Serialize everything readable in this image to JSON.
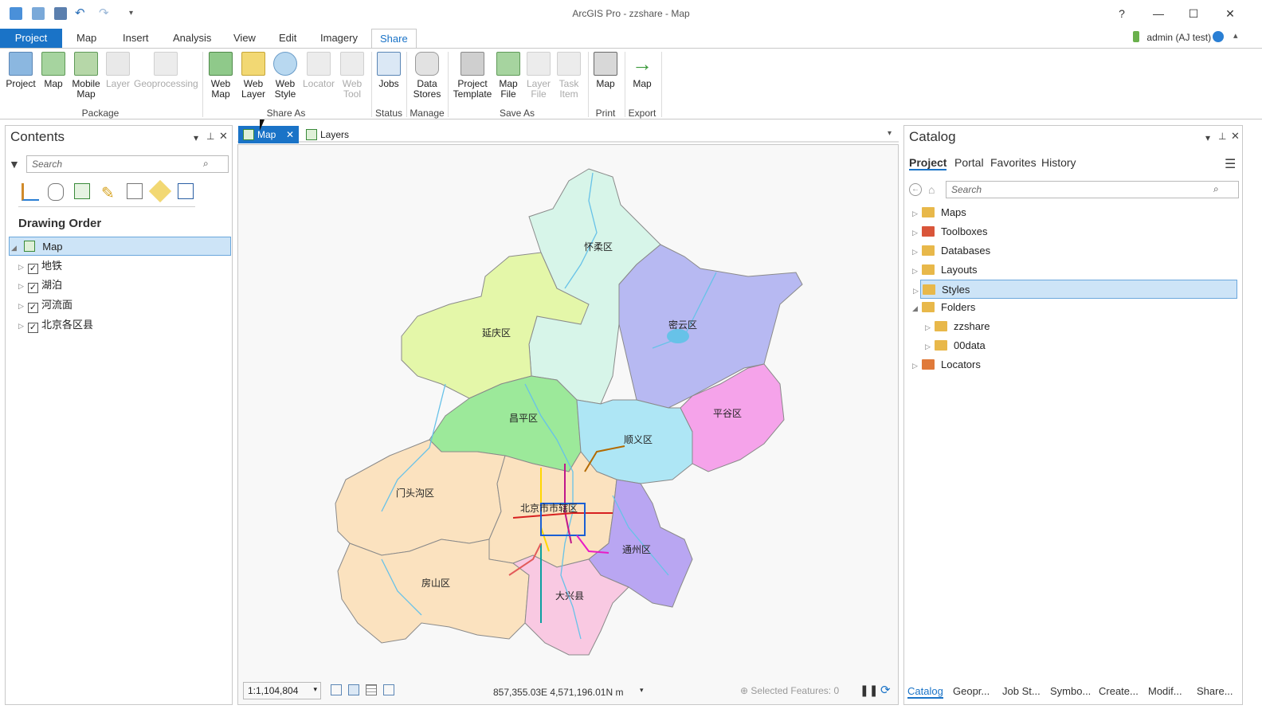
{
  "window": {
    "title": "ArcGIS Pro - zzshare - Map",
    "help": "?",
    "minimize": "—",
    "maximize": "☐",
    "close": "✕"
  },
  "ribbon_tabs": [
    "Project",
    "Map",
    "Insert",
    "Analysis",
    "View",
    "Edit",
    "Imagery",
    "Share"
  ],
  "active_tab": "Share",
  "user": {
    "name": "admin (AJ test)"
  },
  "ribbon": {
    "groups": [
      {
        "label": "Package",
        "buttons": [
          "Project",
          "Map",
          "Mobile Map",
          "Layer",
          "Geoprocessing"
        ]
      },
      {
        "label": "Share As",
        "buttons": [
          "Web Map",
          "Web Layer",
          "Web Style",
          "Locator",
          "Web Tool"
        ]
      },
      {
        "label": "Status",
        "buttons": [
          "Jobs"
        ]
      },
      {
        "label": "Manage",
        "buttons": [
          "Data Stores"
        ]
      },
      {
        "label": "Save As",
        "buttons": [
          "Project Template",
          "Map File",
          "Layer File",
          "Task Item"
        ]
      },
      {
        "label": "Print",
        "buttons": [
          "Map"
        ]
      },
      {
        "label": "Export",
        "buttons": [
          "Map"
        ]
      }
    ]
  },
  "contents": {
    "title": "Contents",
    "search_placeholder": "Search",
    "section": "Drawing Order",
    "map_name": "Map",
    "layers": [
      "地铁",
      "湖泊",
      "河流面",
      "北京各区县"
    ]
  },
  "doc_tabs": [
    "Map",
    "Layers"
  ],
  "map": {
    "districts": [
      {
        "name": "怀柔区",
        "color": "#d7f5e9"
      },
      {
        "name": "密云区",
        "color": "#b7b9f2"
      },
      {
        "name": "延庆区",
        "color": "#e4f7a9"
      },
      {
        "name": "平谷区",
        "color": "#f5a3ea"
      },
      {
        "name": "昌平区",
        "color": "#9ce99a"
      },
      {
        "name": "顺义区",
        "color": "#aee6f5"
      },
      {
        "name": "门头沟区",
        "color": "#fbe2bf"
      },
      {
        "name": "北京市市辖区",
        "color": "#fbe2bf"
      },
      {
        "name": "通州区",
        "color": "#b9a6f2"
      },
      {
        "name": "房山区",
        "color": "#fbe2bf"
      },
      {
        "name": "大兴县",
        "color": "#f9c9e2"
      }
    ],
    "scale": "1:1,104,804",
    "coordinates": "857,355.03E 4,571,196.01N m",
    "selected_features": "Selected Features: 0"
  },
  "catalog": {
    "title": "Catalog",
    "tabs": [
      "Project",
      "Portal",
      "Favorites",
      "History"
    ],
    "search_placeholder": "Search",
    "items": [
      "Maps",
      "Toolboxes",
      "Databases",
      "Layouts",
      "Styles",
      "Folders",
      "zzshare",
      "00data",
      "Locators"
    ],
    "bottom_tabs": [
      "Catalog",
      "Geopr...",
      "Job St...",
      "Symbo...",
      "Create...",
      "Modif...",
      "Share..."
    ]
  },
  "colors": {
    "accent": "#1a73c7",
    "selection": "#cde4f7"
  }
}
